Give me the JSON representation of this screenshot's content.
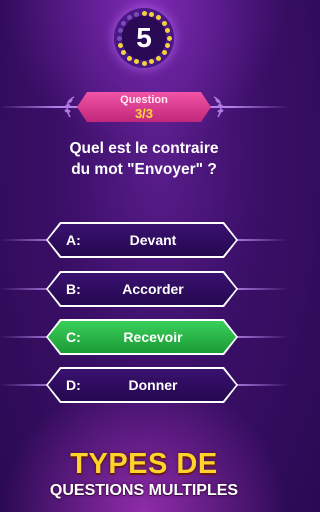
{
  "timer": {
    "value": "5"
  },
  "question_badge": {
    "title": "Question",
    "count": "3/3"
  },
  "question": {
    "line1": "Quel est le contraire",
    "line2": "du mot \"Envoyer\" ?"
  },
  "answers": [
    {
      "letter": "A:",
      "text": "Devant",
      "state": "default"
    },
    {
      "letter": "B:",
      "text": "Accorder",
      "state": "default"
    },
    {
      "letter": "C:",
      "text": "Recevoir",
      "state": "correct"
    },
    {
      "letter": "D:",
      "text": "Donner",
      "state": "default"
    }
  ],
  "promo": {
    "line1": "TYPES DE",
    "line2": "QUESTIONS MULTIPLES"
  },
  "colors": {
    "background": "#3a0f67",
    "badge_pink": "#e0448f",
    "badge_count_yellow": "#ffd83b",
    "correct_green": "#2fbf4c",
    "promo_yellow": "#ffd42a"
  }
}
